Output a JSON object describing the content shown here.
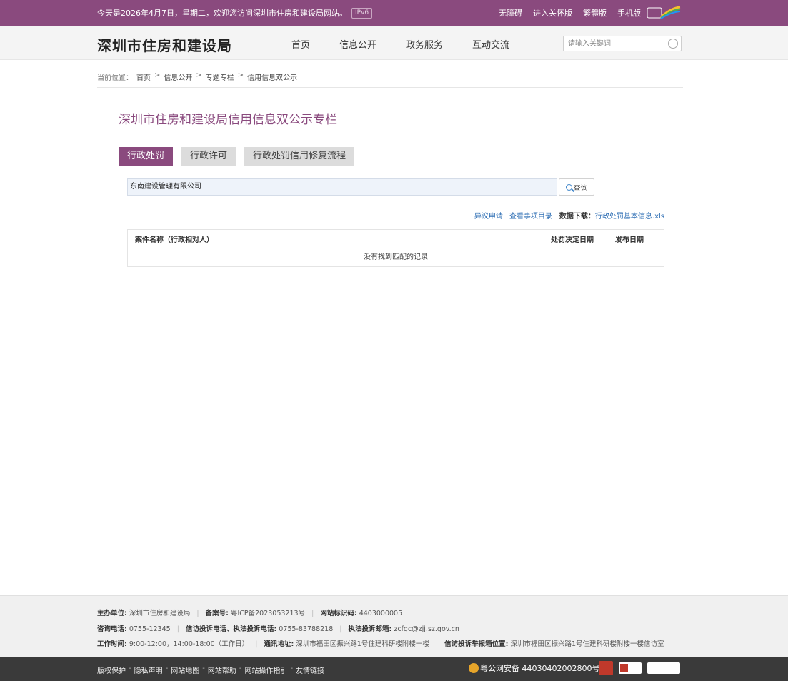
{
  "topbar": {
    "welcome": "今天是2026年4月7日，星期二，欢迎您访问深圳市住房和建设局网站。",
    "ipv6": "IPv6",
    "links": [
      "无障碍",
      "进入关怀版",
      "繁體版",
      "手机版"
    ]
  },
  "header": {
    "site_title": "深圳市住房和建设局",
    "nav": [
      "首页",
      "信息公开",
      "政务服务",
      "互动交流"
    ],
    "search_placeholder": "请输入关键词"
  },
  "breadcrumb": {
    "prefix": "当前位置：",
    "items": [
      "首页",
      "信息公开",
      "专题专栏",
      "信用信息双公示"
    ],
    "separator": ">"
  },
  "page_title": "深圳市住房和建设局信用信息双公示专栏",
  "tabs": [
    {
      "label": "行政处罚",
      "active": true
    },
    {
      "label": "行政许可",
      "active": false
    },
    {
      "label": "行政处罚信用修复流程",
      "active": false
    }
  ],
  "query": {
    "value": "东南建设管理有限公司",
    "button": "查询"
  },
  "actions": {
    "objection": "异议申请",
    "catalog": "查看事项目录",
    "download_label": "数据下载：",
    "download_file": "行政处罚基本信息.xls"
  },
  "table": {
    "headers": [
      "案件名称（行政相对人）",
      "处罚决定日期",
      "发布日期"
    ],
    "empty_text": "没有找到匹配的记录"
  },
  "footer": {
    "host_label": "主办单位:",
    "host": "深圳市住房和建设局",
    "icp_label": "备案号:",
    "icp": "粤ICP备2023053213号",
    "site_id_label": "网站标识码:",
    "site_id": "4403000005",
    "consult_label": "咨询电话:",
    "consult": "0755-12345",
    "complaint_label": "信访投诉电话、执法投诉电话:",
    "complaint": "0755-83788218",
    "email_label": "执法投诉邮箱:",
    "email": "zcfgc@zjj.sz.gov.cn",
    "hours_label": "工作时间:",
    "hours": "9:00-12:00，14:00-18:00（工作日）",
    "address_label": "通讯地址:",
    "address": "深圳市福田区振兴路1号住建科研楼附楼一楼",
    "report_label": "信访投诉举报箱位置:",
    "report": "深圳市福田区振兴路1号住建科研楼附楼一楼信访室",
    "bottom_links": [
      "版权保护",
      "隐私声明",
      "网站地图",
      "网站帮助",
      "网站操作指引",
      "友情链接"
    ],
    "police": "粤公网安备 44030402002800号"
  },
  "colors": {
    "brand": "#8a4a7e",
    "link": "#2b6cb3",
    "bottom_bar": "#3a3a3a"
  }
}
